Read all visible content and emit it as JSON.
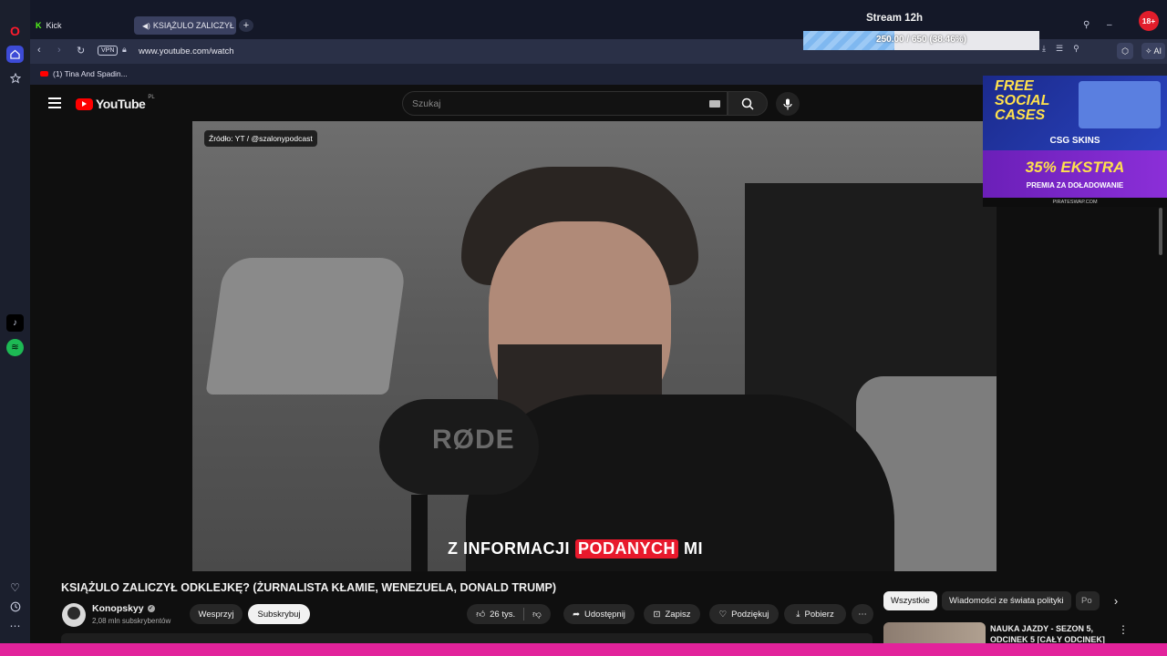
{
  "browser": {
    "tabs": [
      {
        "label": "Kick"
      },
      {
        "label": "KSIĄŻULO ZALICZYŁ O"
      }
    ],
    "url": "www.youtube.com/watch",
    "vpn_label": "VPN",
    "ai_label": "AI",
    "bookmark": "(1) Tina And Spadin..."
  },
  "overlay": {
    "stream_title": "Stream 12h",
    "progress_text": "250.00 / 650 (38.46%)",
    "progress_fraction": 0.3846,
    "age_badge": "18+",
    "ad_line1": "FREE",
    "ad_line2": "SOCIAL",
    "ad_line3": "CASES",
    "ad_brand": "CSG SKINS",
    "ad_promo": "35% EKSTRA",
    "ad_promo_sub": "PREMIA ZA DOŁADOWANIE",
    "ad_site": "PIRATESWAP.COM"
  },
  "youtube": {
    "logo_text": "YouTube",
    "region": "PL",
    "search_placeholder": "Szukaj",
    "video": {
      "source_label": "Źródło: YT / @szalonypodcast",
      "mic_brand": "RØDE",
      "subtitle_part1": "Z INFORMACJI",
      "subtitle_highlight": "PODANYCH",
      "subtitle_part2": "MI"
    },
    "title": "KSIĄŻULO ZALICZYŁ ODKLEJKĘ? (ŻURNALISTA KŁAMIE, WENEZUELA, DONALD TRUMP)",
    "channel": {
      "name": "Konopskyy",
      "subs": "2,08 mln subskrybentów"
    },
    "actions": {
      "support": "Wesprzyj",
      "subscribe": "Subskrybuj",
      "likes": "26 tys.",
      "share": "Udostępnij",
      "save": "Zapisz",
      "thanks": "Podziękuj",
      "download": "Pobierz"
    },
    "chips": [
      "Wszystkie",
      "Wiadomości ze świata polityki",
      "Po"
    ],
    "recommended": {
      "title_line1": "NAUKA JAZDY - SEZON 5,",
      "title_line2": "ODCINEK 5 [CAŁY ODCINEK]"
    }
  },
  "colors": {
    "accent_pink": "#e2239b",
    "youtube_red": "#ff0000",
    "subtitle_highlight": "#e8192c",
    "progress_fill": "#7fb8f0"
  }
}
